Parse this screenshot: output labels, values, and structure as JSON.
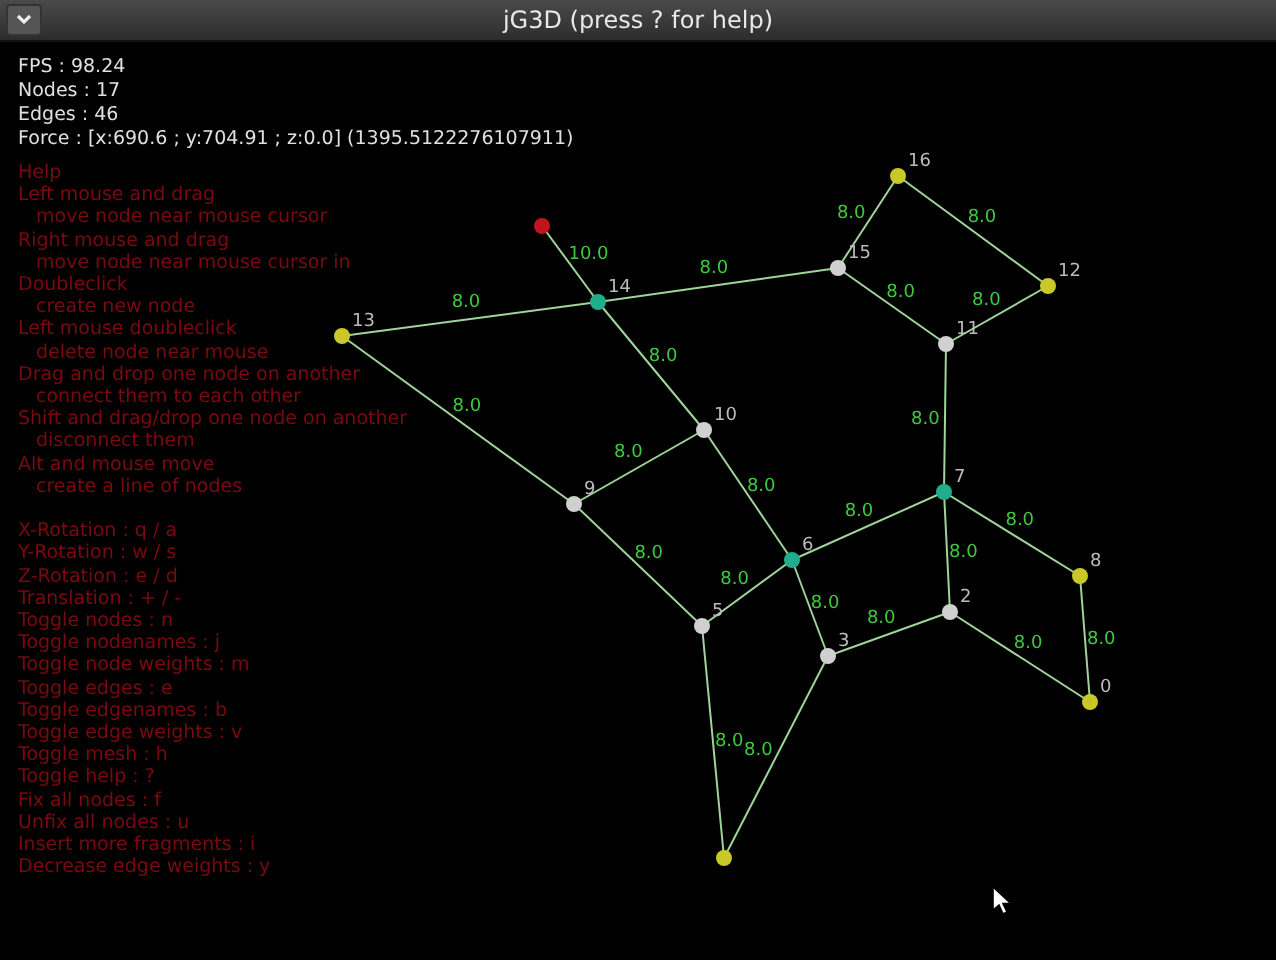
{
  "window": {
    "title": "jG3D (press ? for help)"
  },
  "stats": [
    "FPS : 98.24",
    "Nodes : 17",
    "Edges : 46",
    "Force : [x:690.6 ; y:704.91 ; z:0.0] (1395.5122276107911)"
  ],
  "help": [
    {
      "text": "Help"
    },
    {
      "text": "Left mouse and drag",
      "children": [
        "move node near mouse cursor"
      ]
    },
    {
      "text": "Right mouse and drag",
      "children": [
        "move node near mouse cursor in"
      ]
    },
    {
      "text": "Doubleclick",
      "children": [
        "create new node"
      ]
    },
    {
      "text": "Left mouse doubleclick",
      "children": [
        "delete node near mouse"
      ]
    },
    {
      "text": "Drag and drop one node on another",
      "children": [
        "connect them to each other"
      ]
    },
    {
      "text": "Shift and drag/drop one node on another",
      "children": [
        "disconnect them"
      ]
    },
    {
      "text": "Alt and mouse move",
      "children": [
        "create a line of nodes"
      ]
    }
  ],
  "keys": [
    "X-Rotation : q / a",
    "Y-Rotation : w / s",
    "Z-Rotation : e / d",
    "Translation : + / -",
    "Toggle nodes : n",
    "Toggle nodenames : j",
    "Toggle node weights : m",
    "Toggle edges : e",
    "Toggle edgenames : b",
    "Toggle edge weights : v",
    "Toggle mesh : h",
    "Toggle help : ?",
    "Fix all nodes : f",
    "Unfix all nodes : u",
    "Insert more fragments : i",
    "Decrease edge weights : y"
  ],
  "graph": {
    "nodes": [
      {
        "color": "#c0141e"
      },
      {
        "label": "14",
        "color": "#1fae8c"
      },
      {
        "label": "13",
        "color": "#c8c828"
      },
      {
        "label": "15",
        "color": "#d0d0d0"
      },
      {
        "label": "16",
        "color": "#c8c828"
      },
      {
        "label": "12",
        "color": "#c8c828"
      },
      {
        "label": "11",
        "color": "#d0d0d0"
      },
      {
        "label": "10",
        "color": "#d0d0d0"
      },
      {
        "label": "9",
        "color": "#d0d0d0"
      },
      {
        "label": "7",
        "color": "#1fae8c"
      },
      {
        "label": "6",
        "color": "#1fae8c"
      },
      {
        "label": "5",
        "color": "#d0d0d0"
      },
      {
        "label": "3",
        "color": "#d0d0d0"
      },
      {
        "label": "2",
        "color": "#d0d0d0"
      },
      {
        "label": "8",
        "color": "#c8c828"
      },
      {
        "label": "0",
        "color": "#c8c828"
      },
      {
        "color": "#c8c828"
      }
    ],
    "edges": [
      {
        "weight": "10.0"
      },
      {
        "weight": "8.0"
      },
      {
        "weight": "8.0"
      },
      {
        "weight": "8.0"
      },
      {
        "weight": "8.0"
      },
      {
        "weight": "8.0"
      },
      {
        "weight": "8.0"
      },
      {
        "weight": "8.0"
      },
      {
        "weight": "8.0"
      },
      {
        "weight": "8.0"
      },
      {
        "weight": "8.0"
      },
      {
        "weight": "8.0"
      },
      {
        "weight": "8.0"
      },
      {
        "weight": "8.0"
      },
      {
        "weight": "8.0"
      },
      {
        "weight": "8.0"
      },
      {
        "weight": "8.0"
      },
      {
        "weight": "8.0"
      },
      {
        "weight": "8.0"
      },
      {
        "weight": "8.0"
      },
      {
        "weight": "8.0"
      },
      {
        "weight": "8.0"
      },
      {
        "weight": "8.0"
      }
    ]
  }
}
